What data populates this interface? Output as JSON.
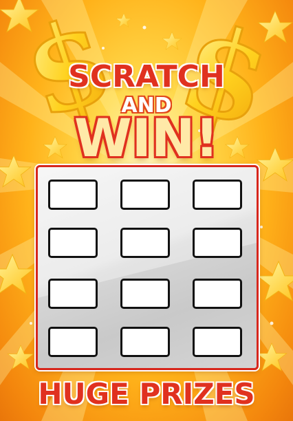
{
  "heading": {
    "line1": "SCRATCH",
    "line2": "AND",
    "line3": "WIN!"
  },
  "footer": {
    "text": "HUGE PRIZES"
  },
  "colors": {
    "title_red": "#e0311f",
    "background_gold": "#ffb21a",
    "panel_border": "#d7261c",
    "panel_silver": "#d6d6d6"
  },
  "decorations": {
    "icons": [
      "dollar-sign-icon",
      "dollar-sign-icon",
      "star-icon"
    ]
  },
  "scratch_grid": {
    "rows": 4,
    "columns": 3,
    "boxes": [
      "",
      "",
      "",
      "",
      "",
      "",
      "",
      "",
      "",
      "",
      "",
      ""
    ]
  }
}
